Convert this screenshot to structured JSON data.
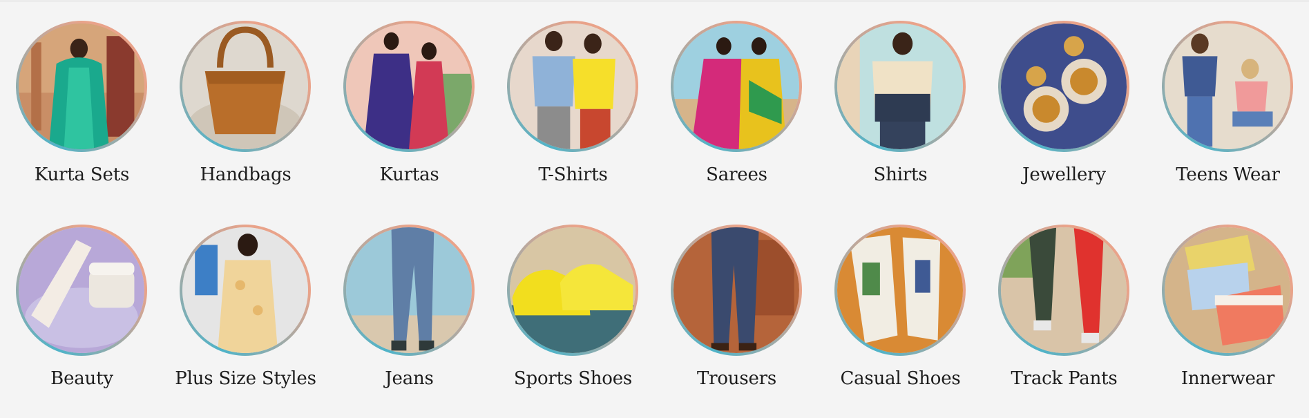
{
  "categories": [
    {
      "label": "Kurta Sets",
      "icon": "kurta-sets-image",
      "ring": "#4fb3c8",
      "accent": "#e9a38a"
    },
    {
      "label": "Handbags",
      "icon": "handbags-image",
      "ring": "#4fb3c8",
      "accent": "#e9a38a"
    },
    {
      "label": "Kurtas",
      "icon": "kurtas-image",
      "ring": "#4fb3c8",
      "accent": "#e9a38a"
    },
    {
      "label": "T-Shirts",
      "icon": "t-shirts-image",
      "ring": "#4fb3c8",
      "accent": "#e9a38a"
    },
    {
      "label": "Sarees",
      "icon": "sarees-image",
      "ring": "#4fb3c8",
      "accent": "#e9a38a"
    },
    {
      "label": "Shirts",
      "icon": "shirts-image",
      "ring": "#4fb3c8",
      "accent": "#e9a38a"
    },
    {
      "label": "Jewellery",
      "icon": "jewellery-image",
      "ring": "#4fb3c8",
      "accent": "#e9a38a"
    },
    {
      "label": "Teens Wear",
      "icon": "teens-wear-image",
      "ring": "#4fb3c8",
      "accent": "#e9a38a"
    },
    {
      "label": "Beauty",
      "icon": "beauty-image",
      "ring": "#4fb3c8",
      "accent": "#e9a38a"
    },
    {
      "label": "Plus Size Styles",
      "icon": "plus-size-styles-image",
      "ring": "#4fb3c8",
      "accent": "#e9a38a"
    },
    {
      "label": "Jeans",
      "icon": "jeans-image",
      "ring": "#4fb3c8",
      "accent": "#e9a38a"
    },
    {
      "label": "Sports Shoes",
      "icon": "sports-shoes-image",
      "ring": "#4fb3c8",
      "accent": "#e9a38a"
    },
    {
      "label": "Trousers",
      "icon": "trousers-image",
      "ring": "#4fb3c8",
      "accent": "#e9a38a"
    },
    {
      "label": "Casual Shoes",
      "icon": "casual-shoes-image",
      "ring": "#4fb3c8",
      "accent": "#e9a38a"
    },
    {
      "label": "Track Pants",
      "icon": "track-pants-image",
      "ring": "#4fb3c8",
      "accent": "#e9a38a"
    },
    {
      "label": "Innerwear",
      "icon": "innerwear-image",
      "ring": "#4fb3c8",
      "accent": "#e9a38a"
    }
  ]
}
